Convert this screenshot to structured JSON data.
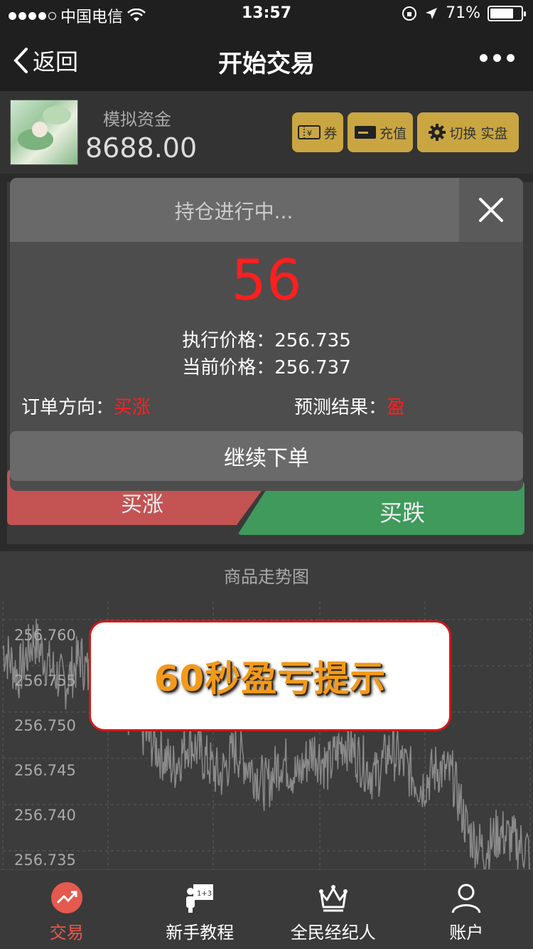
{
  "status_bar": {
    "carrier": "中国电信",
    "time": "13:57",
    "battery_percent": "71%"
  },
  "nav": {
    "back_label": "返回",
    "title": "开始交易"
  },
  "account": {
    "fund_label": "模拟资金",
    "fund_value": "8688.00",
    "buttons": {
      "coupon": "券",
      "recharge": "充值",
      "switch": "切换 实盘"
    }
  },
  "trade_buttons": {
    "buy_up": "买涨",
    "buy_down": "买跌"
  },
  "modal": {
    "title": "持仓进行中...",
    "countdown": "56",
    "exec_price_label": "执行价格：",
    "exec_price_value": "256.735",
    "current_price_label": "当前价格：",
    "current_price_value": "256.737",
    "direction_label": "订单方向：",
    "direction_value": "买涨",
    "prediction_label": "预测结果：",
    "prediction_value": "盈",
    "continue_label": "继续下单",
    "accent_color": "#ff1f1f"
  },
  "chart": {
    "title": "商品走势图",
    "y_ticks": [
      "256.760",
      "256.755",
      "256.750",
      "256.745",
      "256.740",
      "256.735"
    ]
  },
  "chart_data": {
    "type": "line",
    "title": "商品走势图",
    "ylim": [
      256.733,
      256.762
    ],
    "y_ticks": [
      256.76,
      256.755,
      256.75,
      256.745,
      256.74,
      256.735
    ],
    "grid": true,
    "series": [
      {
        "values": [
          256.757,
          256.754,
          256.758,
          256.755,
          256.753,
          256.756,
          256.752,
          256.755,
          256.75,
          256.748,
          256.746,
          256.744,
          256.747,
          256.745,
          256.743,
          256.746,
          256.744,
          256.742,
          256.745,
          256.743,
          256.746,
          256.744,
          256.747,
          256.745,
          256.743,
          256.746,
          256.744,
          256.742,
          256.744,
          256.743,
          256.737,
          256.735,
          256.737,
          256.736,
          256.735
        ]
      }
    ]
  },
  "banner": {
    "text": "60秒盈亏提示"
  },
  "tabs": [
    {
      "label": "交易"
    },
    {
      "label": "新手教程"
    },
    {
      "label": "全民经纪人"
    },
    {
      "label": "账户"
    }
  ]
}
